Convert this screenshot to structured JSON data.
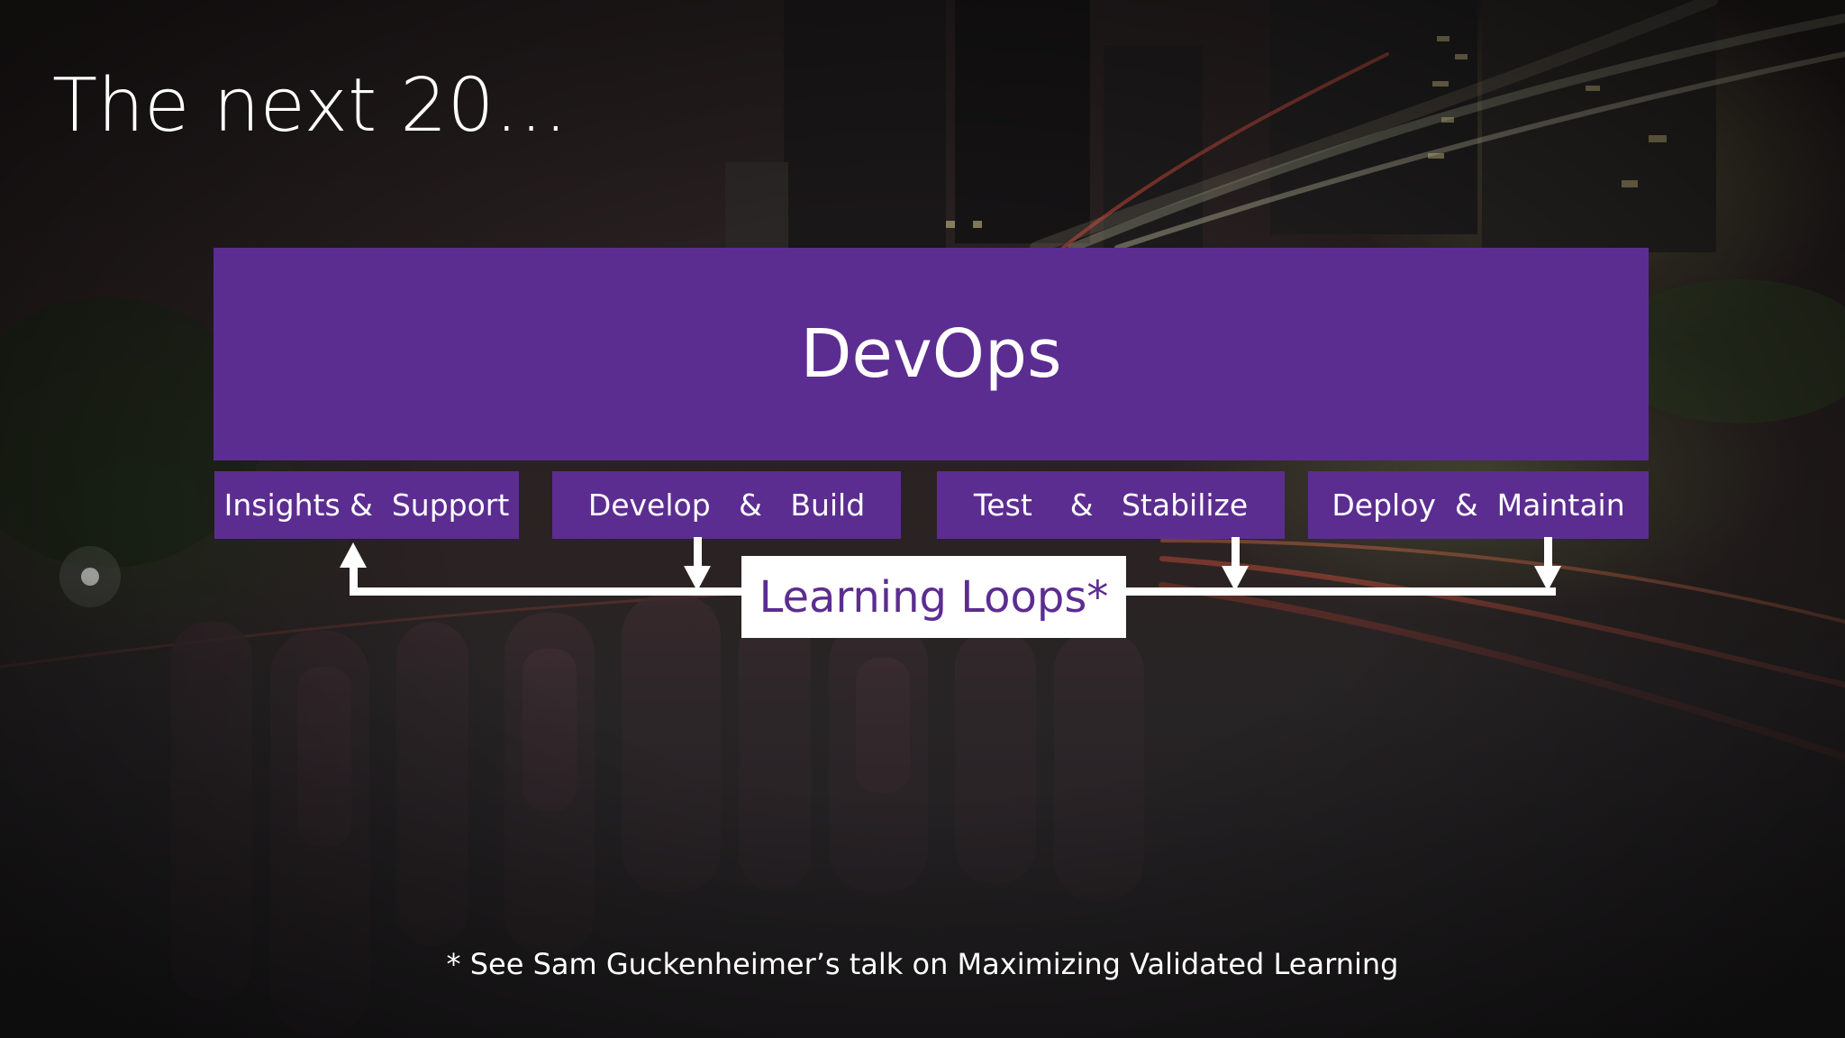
{
  "slide": {
    "title": "The next 20…",
    "devops": {
      "label": "DevOps",
      "color": "#5c2d91"
    },
    "stages": [
      {
        "label": "Insights &  Support"
      },
      {
        "label": "Develop   &   Build"
      },
      {
        "label": "Test    &   Stabilize"
      },
      {
        "label": "Deploy  &  Maintain"
      }
    ],
    "loops": {
      "label": "Learning Loops*",
      "text_color": "#5c2d91",
      "box_color": "#ffffff"
    },
    "footnote": "* See Sam Guckenheimer’s talk on Maximizing Validated Learning",
    "background": {
      "description_icon": "city-night-photo"
    }
  }
}
